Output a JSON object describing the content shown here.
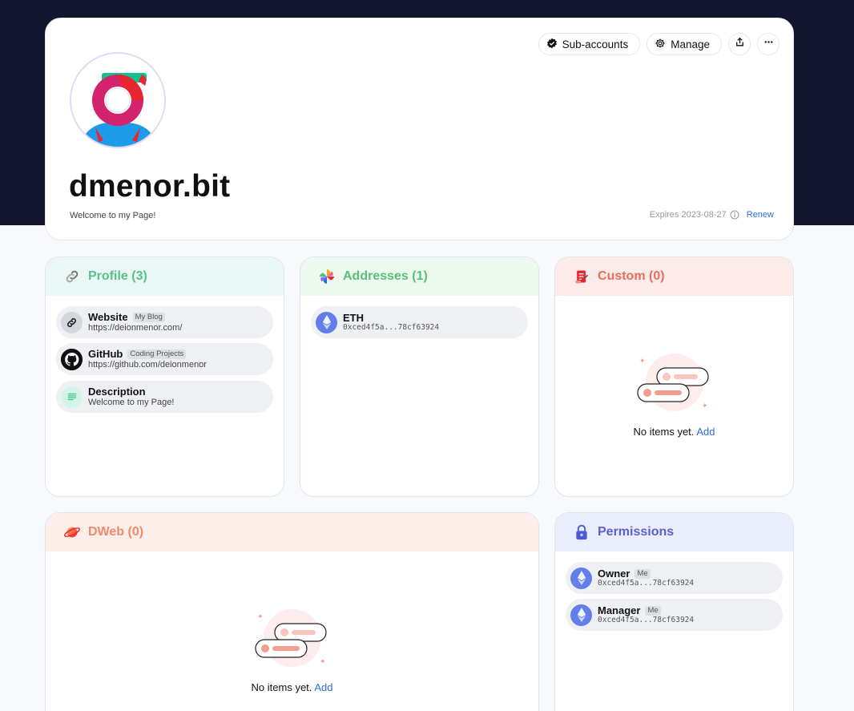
{
  "header": {
    "actions": {
      "sub_accounts": "Sub-accounts",
      "manage": "Manage"
    },
    "domain": "dmenor.bit",
    "tagline": "Welcome to my Page!",
    "expiry": "Expires 2023-08-27",
    "renew": "Renew"
  },
  "profile": {
    "title": "Profile (3)",
    "items": [
      {
        "title": "Website",
        "badge": "My Blog",
        "value": "https://deionmenor.com/"
      },
      {
        "title": "GitHub",
        "badge": "Coding Projects",
        "value": "https://github.com/deionmenor"
      },
      {
        "title": "Description",
        "value": "Welcome to my Page!"
      }
    ]
  },
  "addresses": {
    "title": "Addresses (1)",
    "items": [
      {
        "title": "ETH",
        "value": "0xced4f5a...78cf63924"
      }
    ]
  },
  "custom": {
    "title": "Custom (0)",
    "empty_text": "No items yet.",
    "add": "Add"
  },
  "dweb": {
    "title": "DWeb (0)",
    "empty_text": "No items yet.",
    "add": "Add"
  },
  "permissions": {
    "title": "Permissions",
    "items": [
      {
        "title": "Owner",
        "badge": "Me",
        "value": "0xced4f5a...78cf63924"
      },
      {
        "title": "Manager",
        "badge": "Me",
        "value": "0xced4f5a...78cf63924"
      }
    ]
  },
  "colors": {
    "top_band": "#11152d",
    "profile_accent": "#5cbf8f",
    "addresses_accent": "#5cbf73",
    "custom_accent": "#e76e5c",
    "dweb_accent": "#ee8a6c",
    "permissions_accent": "#5b5fd0",
    "link": "#2b6cde"
  }
}
